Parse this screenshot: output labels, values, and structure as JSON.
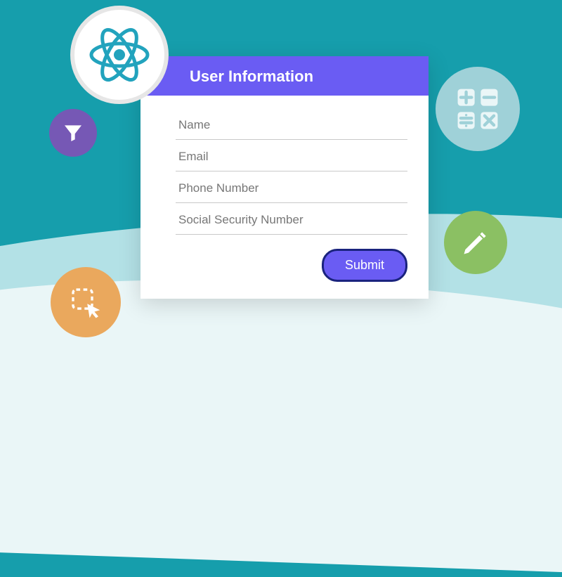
{
  "form": {
    "title": "User Information",
    "fields": {
      "name": "Name",
      "email": "Email",
      "phone": "Phone Number",
      "ssn": "Social Security Number"
    },
    "submit_label": "Submit"
  }
}
